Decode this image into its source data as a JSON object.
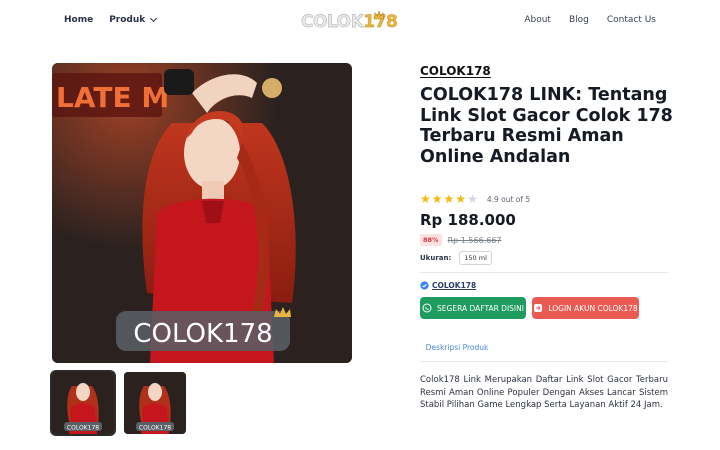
{
  "nav": {
    "home": "Home",
    "produk": "Produk",
    "about": "About",
    "blog": "Blog",
    "contact": "Contact Us"
  },
  "logo": {
    "text_main": "COLOK",
    "text_num": "178"
  },
  "gallery": {
    "image_caption": "COLOK178",
    "thumb_caption": "COLOK178",
    "sign_text": "LATE M"
  },
  "product": {
    "brand": "COLOK178",
    "title": "COLOK178 LINK: Tentang Link Slot Gacor Colok 178 Terbaru Resmi Aman Online Andalan",
    "rating_value": 4.9,
    "rating_text": "4.9 out of 5",
    "stars_filled": 4,
    "stars_total": 5,
    "price": "Rp 188.000",
    "discount": "88%",
    "old_price": "Rp 1.566.667",
    "size_label": "Ukuran:",
    "size_value": "150 ml",
    "seller": "COLOK178"
  },
  "buttons": {
    "daftar": "SEGERA DAFTAR DISINI",
    "login": "LOGIN AKUN COLOK178"
  },
  "tabs": {
    "description": "Deskripsi Produk"
  },
  "description": "Colok178 Link Merupakan Daftar Link Slot Gacor Terbaru Resmi Aman Online Populer Dengan Akses Lancar Sistem Stabil Pilihan Game Lengkap Serta Layanan Aktif 24 Jam.",
  "colors": {
    "accent_green": "#1e9b5e",
    "accent_red": "#ec5b53",
    "tab_blue": "#4a8ad6",
    "star": "#f5b90a",
    "discount_text": "#d9363e"
  }
}
